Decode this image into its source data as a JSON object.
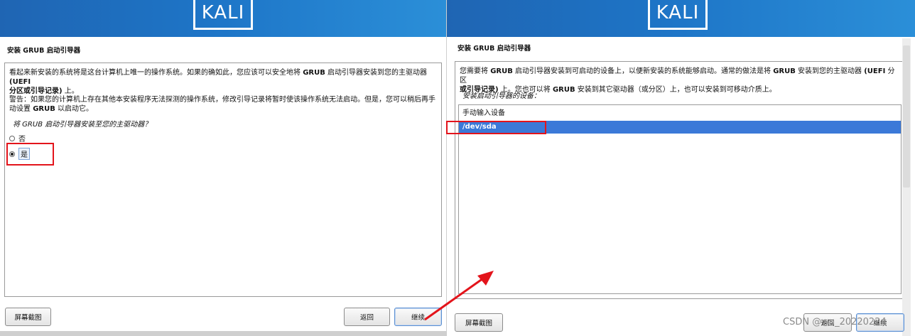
{
  "left": {
    "logo": "KALI",
    "title": "安装 GRUB 启动引导器",
    "para1_a": "看起来新安装的系统将是这台计算机上唯一的操作系统。如果的确如此，您应该可以安全地将 ",
    "para1_b": "GRUB",
    "para1_c": " 启动引导器安装到您的主驱动器 ",
    "para1_d": "(UEFI",
    "para1_e": "分区或引导记录)",
    "para1_f": " 上。",
    "para2_a": "警告：如果您的计算机上存在其他本安装程序无法探测的操作系统，修改引导记录将暂时使该操作系统无法启动。但是，您可以稍后再手动设置 ",
    "para2_b": "GRUB",
    "para2_c": " 以启动它。",
    "prompt": "将 GRUB 启动引导器安装至您的主驱动器？",
    "options": [
      {
        "label": "否",
        "selected": false
      },
      {
        "label": "是",
        "selected": true
      }
    ],
    "buttons": {
      "screenshot": "屏幕截图",
      "back": "返回",
      "continue": "继续"
    }
  },
  "right": {
    "logo": "KALI",
    "title": "安装 GRUB 启动引导器",
    "para1_a": "您需要将 ",
    "para1_b": "GRUB",
    "para1_c": " 启动引导器安装到可启动的设备上，以便新安装的系统能够启动。通常的做法是将 ",
    "para1_d": "GRUB",
    "para1_e": " 安装到您的主驱动器 ",
    "para1_f": "(UEFI",
    "para1_g": " 分区",
    "para2_a": "或引导记录)",
    "para2_b": " 上。您也可以将 ",
    "para2_c": "GRUB",
    "para2_d": " 安装到其它驱动器（或分区）上，也可以安装到可移动介质上。",
    "prompt": "安装启动引导器的设备：",
    "list_items": [
      {
        "label": "手动输入设备",
        "selected": false
      },
      {
        "label": "/dev/sda",
        "selected": true
      }
    ],
    "buttons": {
      "screenshot": "屏幕截图",
      "back": "返回",
      "continue": "继续"
    }
  },
  "watermark": "CSDN @wu_20220224",
  "colors": {
    "banner": "#1e76c8",
    "selection": "#3b79d8",
    "annotation": "#e3141b"
  }
}
